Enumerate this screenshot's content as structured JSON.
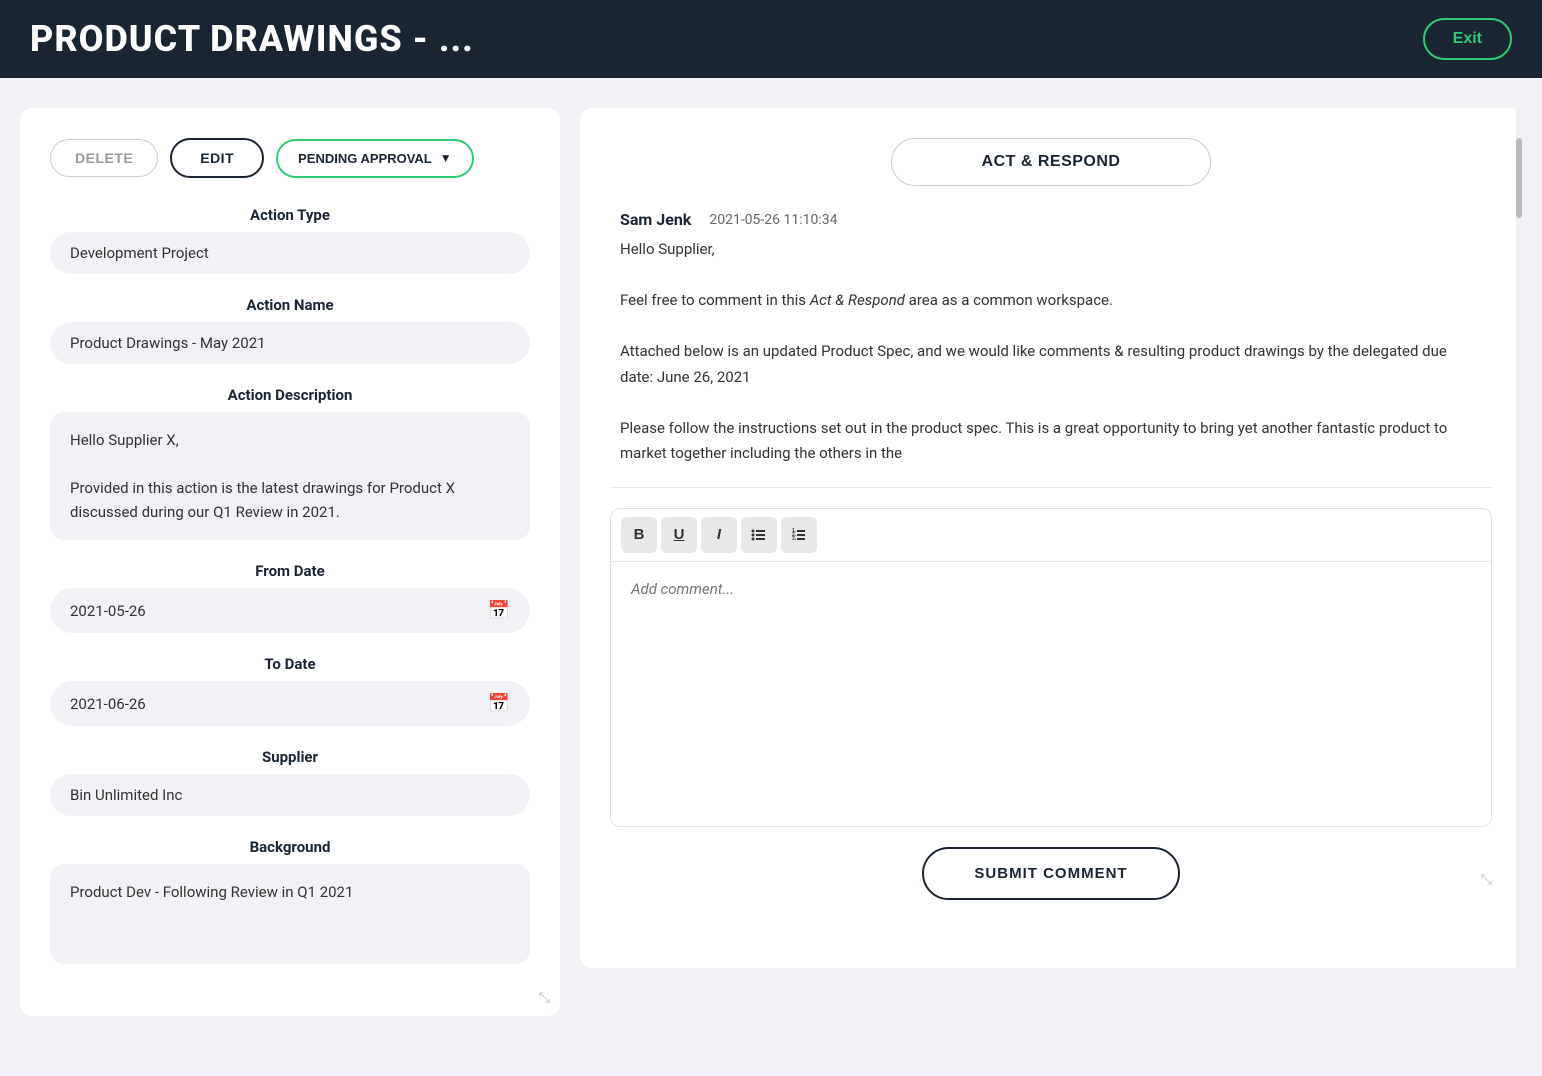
{
  "header": {
    "title": "PRODUCT DRAWINGS - ...",
    "exit_label": "Exit"
  },
  "toolbar": {
    "delete_label": "DELETE",
    "edit_label": "EDIT",
    "pending_label": "PENDING APPROVAL"
  },
  "left_panel": {
    "action_type_label": "Action Type",
    "action_type_value": "Development Project",
    "action_name_label": "Action Name",
    "action_name_value": "Product Drawings - May 2021",
    "action_description_label": "Action Description",
    "action_description_line1": "Hello Supplier X,",
    "action_description_line2": "Provided in this action is the latest drawings for Product X discussed during our Q1 Review in 2021.",
    "from_date_label": "From Date",
    "from_date_value": "2021-05-26",
    "to_date_label": "To Date",
    "to_date_value": "2021-06-26",
    "supplier_label": "Supplier",
    "supplier_value": "Bin Unlimited Inc",
    "background_label": "Background",
    "background_value": "Product Dev - Following Review in Q1 2021"
  },
  "right_panel": {
    "act_respond_label": "ACT & RESPOND",
    "message": {
      "author": "Sam Jenk",
      "timestamp": "2021-05-26 11:10:34",
      "greeting": "Hello Supplier,",
      "line1": "Feel free to comment in this Act & Respond area as a common workspace.",
      "line2": "Attached below is an updated Product Spec, and we would like comments & resulting product drawings by the delegated due date: June 26, 2021",
      "line3": "Please follow the instructions set out in the product spec. This is a great opportunity to bring yet another fantastic product to market together including the others in the"
    },
    "format_buttons": {
      "bold": "B",
      "underline": "U",
      "italic": "I",
      "bullet_list": "☰",
      "numbered_list": "≡"
    },
    "comment_placeholder": "Add comment...",
    "submit_label": "SUBMIT COMMENT"
  }
}
